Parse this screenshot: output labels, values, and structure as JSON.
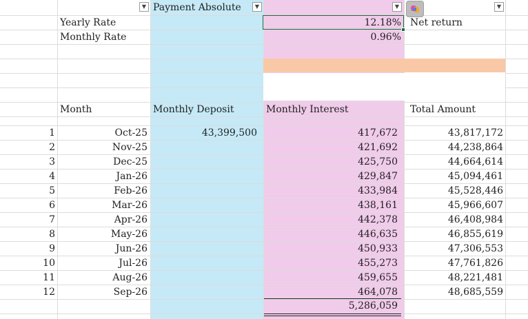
{
  "header_row": {
    "payment_absolute": "Payment Absolute"
  },
  "labels": {
    "yearly_rate": "Yearly Rate",
    "monthly_rate": "Monthly Rate",
    "net_return": "Net return"
  },
  "values": {
    "yearly_rate": "12.18%",
    "monthly_rate": "0.96%"
  },
  "table": {
    "headers": {
      "month": "Month",
      "monthly_deposit": "Monthly Deposit",
      "monthly_interest": "Monthly Interest",
      "total_amount": "Total Amount"
    },
    "rows": [
      {
        "n": "1",
        "month": "Oct-25",
        "deposit": "43,399,500",
        "interest": "417,672",
        "total": "43,817,172"
      },
      {
        "n": "2",
        "month": "Nov-25",
        "deposit": "",
        "interest": "421,692",
        "total": "44,238,864"
      },
      {
        "n": "3",
        "month": "Dec-25",
        "deposit": "",
        "interest": "425,750",
        "total": "44,664,614"
      },
      {
        "n": "4",
        "month": "Jan-26",
        "deposit": "",
        "interest": "429,847",
        "total": "45,094,461"
      },
      {
        "n": "5",
        "month": "Feb-26",
        "deposit": "",
        "interest": "433,984",
        "total": "45,528,446"
      },
      {
        "n": "6",
        "month": "Mar-26",
        "deposit": "",
        "interest": "438,161",
        "total": "45,966,607"
      },
      {
        "n": "7",
        "month": "Apr-26",
        "deposit": "",
        "interest": "442,378",
        "total": "46,408,984"
      },
      {
        "n": "8",
        "month": "May-26",
        "deposit": "",
        "interest": "446,635",
        "total": "46,855,619"
      },
      {
        "n": "9",
        "month": "Jun-26",
        "deposit": "",
        "interest": "450,933",
        "total": "47,306,553"
      },
      {
        "n": "10",
        "month": "Jul-26",
        "deposit": "",
        "interest": "455,273",
        "total": "47,761,826"
      },
      {
        "n": "11",
        "month": "Aug-26",
        "deposit": "",
        "interest": "459,655",
        "total": "48,221,481"
      },
      {
        "n": "12",
        "month": "Sep-26",
        "deposit": "",
        "interest": "464,078",
        "total": "48,685,559"
      }
    ],
    "interest_total": "5,286,059"
  },
  "icons": {
    "filter": "filter-dropdown-icon",
    "copilot": "copilot-icon"
  },
  "colors": {
    "deposit_column": "#c5e9f7",
    "interest_column": "#f0cbea",
    "peach_band": "#f9c8a6",
    "selection": "#1e6e3a"
  }
}
